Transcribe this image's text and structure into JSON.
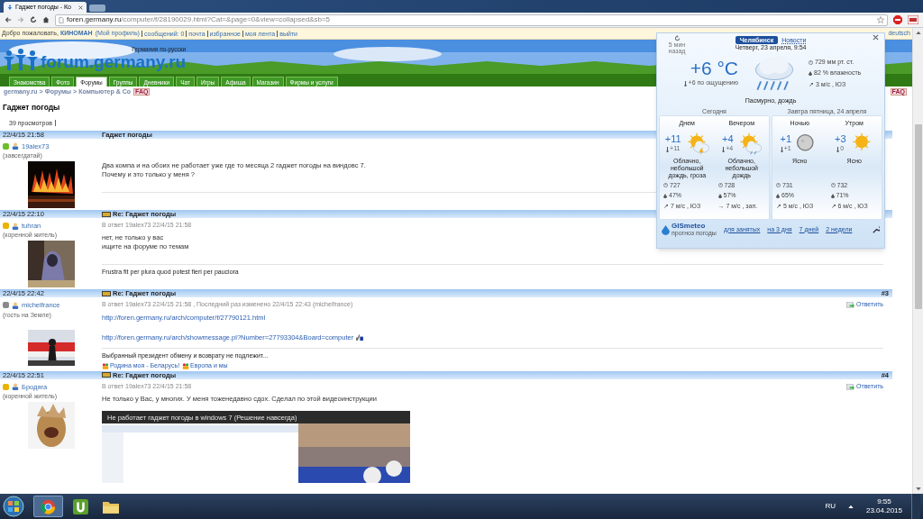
{
  "browser": {
    "tab_title": "Гаджет погоды - Ко",
    "url_host": "foren.germany.ru",
    "url_path": "/computer/f/28190029.html?Cat=&page=0&view=collapsed&sb=5"
  },
  "welcome_bar": {
    "greeting": "Добро пожаловать,",
    "user": "КИНОМАН",
    "profile": "(Мой профиль)",
    "links": [
      "сообщений: 0",
      "почта",
      "избранное",
      "моя лента",
      "выйти"
    ],
    "language": "deutsch"
  },
  "site": {
    "logo": "forum.germany.ru",
    "tagline": "Германия по-русски"
  },
  "nav": [
    {
      "label": "Знакомства",
      "selected": false
    },
    {
      "label": "Фото",
      "selected": false
    },
    {
      "label": "Форумы",
      "selected": true
    },
    {
      "label": "Группы",
      "selected": false
    },
    {
      "label": "Дневники",
      "selected": false
    },
    {
      "label": "Чат",
      "selected": false
    },
    {
      "label": "Игры",
      "selected": false
    },
    {
      "label": "Афиша",
      "selected": false
    },
    {
      "label": "Магазин",
      "selected": false
    },
    {
      "label": "Фирмы и услуги",
      "selected": false
    }
  ],
  "breadcrumb": {
    "items": [
      "germany.ru",
      "Форумы",
      "Компьютер & Co"
    ],
    "separator": ">",
    "badge": "FAQ",
    "right_badge": "FAQ"
  },
  "thread": {
    "title": "Гаджет погоды",
    "views": "39 просмотров"
  },
  "posts": [
    {
      "date": "22/4/15 21:58",
      "title": "Гаджет погоды",
      "new": false,
      "author": "19alex73",
      "rank": "(завсегдатай)",
      "color": "#6cbf2a",
      "body": [
        "Два компа и на обоих не работает уже где то месяца 2 гаджет погоды на виндовс 7.",
        "Почему и это только у меня ?"
      ]
    },
    {
      "date": "22/4/15 22:10",
      "title": "Re: Гаджет погоды",
      "new": true,
      "author": "tuhran",
      "rank": "(коренной житель)",
      "color": "#e8b400",
      "reply_to": "В ответ 19alex73 22/4/15 21:58",
      "body": [
        "нет, не только у вас",
        "ищите на форуме по темам"
      ],
      "signature": "Frustra fit per plura quod potest fieri per pauciora"
    },
    {
      "date": "22/4/15 22:42",
      "title": "Re: Гаджет погоды",
      "new": true,
      "number": "#3",
      "reply_button": "Ответить",
      "author": "michelfrance",
      "rank": "(гость на Земле)",
      "color": "#8a8a8a",
      "reply_to": "В ответ 19alex73 22/4/15 21:58 , Последний раз изменено 22/4/15 22:43 (michelfrance)",
      "links": [
        "http://foren.germany.ru/arch/computer/f/27790121.html",
        "http://foren.germany.ru/arch/showmessage.pl?Number=27793304&Board=computer"
      ],
      "signature": "Выбранный президент обмену и возврату не подлежит...",
      "signature_links": [
        "Родина моя - Беларусь!",
        "Европа и мы"
      ]
    },
    {
      "date": "22/4/15 22:51",
      "title": "Re: Гаджет погоды",
      "new": true,
      "number": "#4",
      "reply_button": "Ответить",
      "author": "Бродяга",
      "rank": "(коренной житель)",
      "color": "#e8b400",
      "reply_to": "В ответ 19alex73 22/4/15 21:58",
      "body": [
        "Не только у Вас, у многих. У меня тоженедавно сдох. Сделал по этой видеоинструкции"
      ],
      "video": {
        "title": "Не работает гаджет погоды в windows 7 (Решение навсегда)"
      }
    }
  ],
  "weather": {
    "updated": "5 мин назад",
    "tabs": [
      {
        "label": "Челябинск",
        "selected": true
      },
      {
        "label": "Новости",
        "selected": false
      }
    ],
    "date": "Четверг, 23 апреля, 9:54",
    "temperature": "+6 °C",
    "feels": "+6 по ощущению",
    "pressure": "729 мм рт. ст.",
    "humidity": "82 % влажность",
    "wind": "↗ 3 м/с , ЮЗ",
    "condition": "Пасмурно, дождь",
    "groups": [
      {
        "label": "Сегодня",
        "periods": [
          {
            "name": "Днем",
            "kind": "storm",
            "temp": "+11",
            "feels": "+11",
            "condition": "Облачно, небольшой дождь, гроза",
            "pressure": "727",
            "humidity": "47%",
            "wind": "↗ 7 м/с , ЮЗ"
          },
          {
            "name": "Вечером",
            "kind": "rain",
            "temp": "+4",
            "feels": "+4",
            "condition": "Облачно, небольшой дождь",
            "pressure": "728",
            "humidity": "57%",
            "wind": "→ 7 м/с , зап."
          }
        ]
      },
      {
        "label": "Завтра пятница, 24 апреля",
        "periods": [
          {
            "name": "Ночью",
            "kind": "moon",
            "temp": "+1",
            "feels": "+1",
            "condition": "Ясно",
            "pressure": "731",
            "humidity": "65%",
            "wind": "↗ 5 м/с , ЮЗ"
          },
          {
            "name": "Утром",
            "kind": "sun",
            "temp": "+3",
            "feels": "0",
            "condition": "Ясно",
            "pressure": "732",
            "humidity": "71%",
            "wind": "↗ 6 м/с , ЮЗ"
          }
        ]
      }
    ],
    "brand": "GISmeteo",
    "brand_sub": "прогноз погоды",
    "links": [
      "для занятых",
      "на 3 дня",
      "7 дней",
      "2 недели"
    ]
  },
  "taskbar": {
    "language": "RU",
    "time": "9:55",
    "date": "23.04.2015"
  }
}
